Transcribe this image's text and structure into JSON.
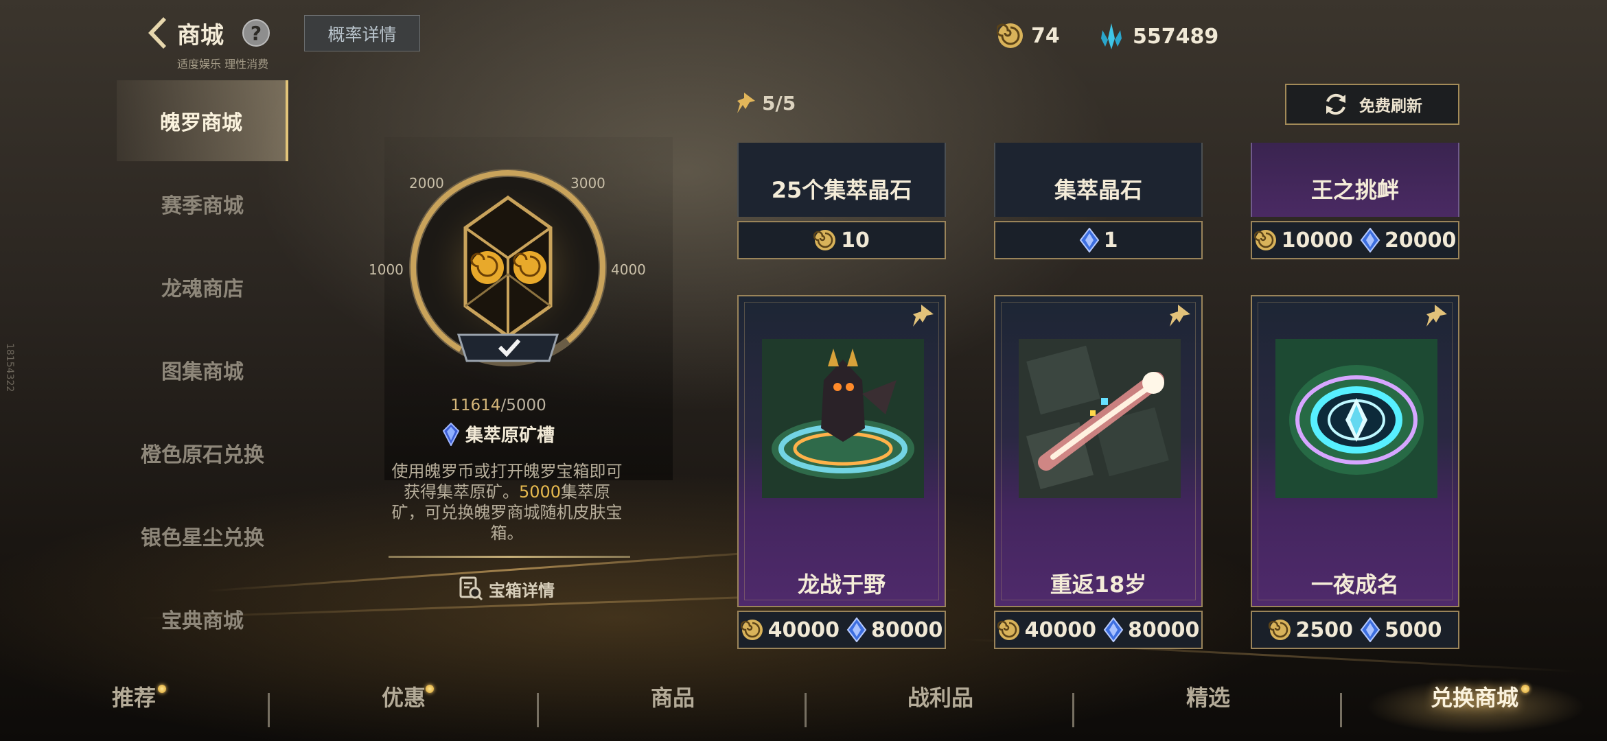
{
  "header": {
    "title": "商城",
    "subtitle": "适度娱乐 理性消费",
    "help_glyph": "?",
    "prob_button": "概率详情"
  },
  "currency": {
    "coin_amount": "74",
    "crystal_amount": "557489"
  },
  "sidebar": {
    "items": [
      {
        "label": "魄罗商城",
        "active": true
      },
      {
        "label": "赛季商城"
      },
      {
        "label": "龙魂商店"
      },
      {
        "label": "图集商城"
      },
      {
        "label": "橙色原石兑换"
      },
      {
        "label": "银色星尘兑换"
      },
      {
        "label": "宝典商城"
      }
    ]
  },
  "chest": {
    "ring_labels": [
      "2000",
      "3000",
      "1000",
      "4000"
    ],
    "progress_current": "11614",
    "progress_sep": "/",
    "progress_target": "5000",
    "progress_fraction": 1.0,
    "slot_label": "集萃原矿槽",
    "description_part1": "使用魄罗币或打开魄罗宝箱即可获得集萃原矿。",
    "description_highlight": "5000",
    "description_part2": "集萃原矿，可兑换魄罗商城随机皮肤宝箱。",
    "details_link": "宝箱详情"
  },
  "shop": {
    "pins": "5/5",
    "refresh_label": "免费刷新",
    "top_items": [
      {
        "name": "25个集萃晶石",
        "prices": [
          {
            "type": "coin",
            "value": "10"
          }
        ]
      },
      {
        "name": "集萃晶石",
        "prices": [
          {
            "type": "crystal",
            "value": "1"
          }
        ]
      },
      {
        "name": "王之挑衅",
        "prices": [
          {
            "type": "coin",
            "value": "10000"
          },
          {
            "type": "crystal",
            "value": "20000"
          }
        ]
      }
    ],
    "items": [
      {
        "name": "龙战于野",
        "prices": [
          {
            "type": "coin",
            "value": "40000"
          },
          {
            "type": "crystal",
            "value": "80000"
          }
        ]
      },
      {
        "name": "重返18岁",
        "prices": [
          {
            "type": "coin",
            "value": "40000"
          },
          {
            "type": "crystal",
            "value": "80000"
          }
        ]
      },
      {
        "name": "一夜成名",
        "prices": [
          {
            "type": "coin",
            "value": "2500"
          },
          {
            "type": "crystal",
            "value": "5000"
          }
        ]
      }
    ]
  },
  "bottom_nav": [
    {
      "label": "推荐",
      "dot": true
    },
    {
      "label": "优惠",
      "dot": true
    },
    {
      "label": "商品"
    },
    {
      "label": "战利品"
    },
    {
      "label": "精选"
    },
    {
      "label": "兑换商城",
      "active": true,
      "dot": true
    }
  ],
  "side_id": "18154322",
  "colors": {
    "gold": "#d5b77a",
    "coin": "#d9b35a",
    "crystal": "#3fc6e8",
    "purple": "#4f2a6b",
    "highlight": "#e6b94e"
  }
}
